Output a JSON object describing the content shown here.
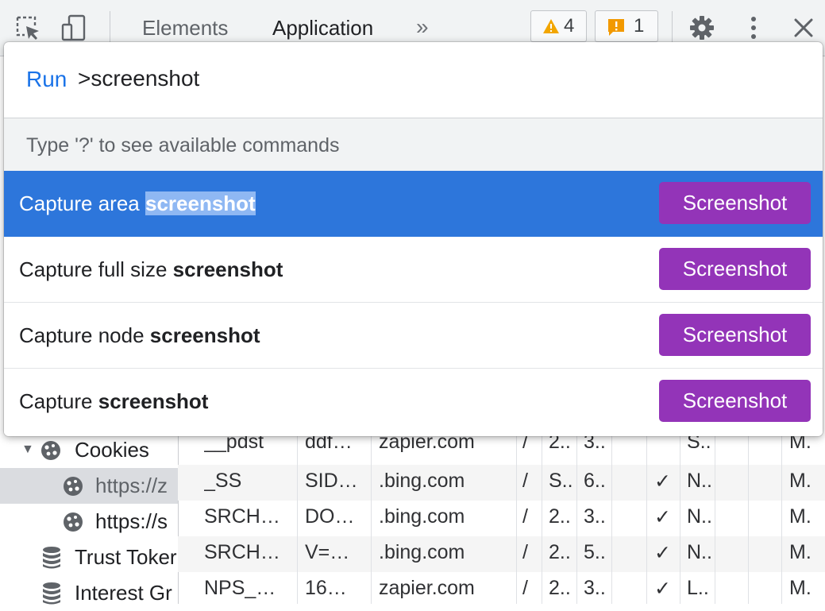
{
  "toolbar": {
    "tabs": [
      "Elements",
      "Application"
    ],
    "more_label": "»",
    "warnings_count": "4",
    "issues_count": "1",
    "icons": [
      "inspect-element-icon",
      "device-toolbar-icon",
      "warning-icon",
      "issue-icon",
      "gear-icon",
      "kebab-menu-icon",
      "close-icon"
    ],
    "colors": {
      "warning": "#f2a600",
      "issue": "#f29900"
    }
  },
  "palette": {
    "prefix": "Run",
    "query": ">screenshot",
    "hint": "Type '?' to see available commands",
    "items": [
      {
        "text": "Capture area ",
        "keyword": "screenshot",
        "button": "Screenshot"
      },
      {
        "text": "Capture full size ",
        "keyword": "screenshot",
        "button": "Screenshot"
      },
      {
        "text": "Capture node ",
        "keyword": "screenshot",
        "button": "Screenshot"
      },
      {
        "text": "Capture ",
        "keyword": "screenshot",
        "button": "Screenshot"
      }
    ],
    "colors": {
      "selected": "#2d76db",
      "button": "#9334b8"
    }
  },
  "sidebar": {
    "items": [
      {
        "label": "Cookies",
        "icon": "cookie-icon"
      },
      {
        "label": "https://z",
        "icon": "cookie-icon"
      },
      {
        "label": "https://s",
        "icon": "cookie-icon"
      },
      {
        "label": "Trust Toker",
        "icon": "database-icon"
      },
      {
        "label": "Interest Gr",
        "icon": "database-icon"
      }
    ]
  },
  "cookies_table": {
    "rows": [
      [
        "__pdst",
        "ddf…",
        "zapier.com",
        "/",
        "2..",
        "3..",
        "",
        "S..",
        "",
        "M."
      ],
      [
        "_SS",
        "SID…",
        ".bing.com",
        "/",
        "S..",
        "6..",
        "✓",
        "N..",
        "",
        "M."
      ],
      [
        "SRCH…",
        "DO…",
        ".bing.com",
        "/",
        "2..",
        "3..",
        "✓",
        "N..",
        "",
        "M."
      ],
      [
        "SRCH…",
        "V=…",
        ".bing.com",
        "/",
        "2..",
        "5..",
        "✓",
        "N..",
        "",
        "M."
      ],
      [
        "NPS_…",
        "16…",
        "zapier.com",
        "/",
        "2..",
        "3..",
        "✓",
        "L..",
        "",
        "M."
      ]
    ]
  }
}
